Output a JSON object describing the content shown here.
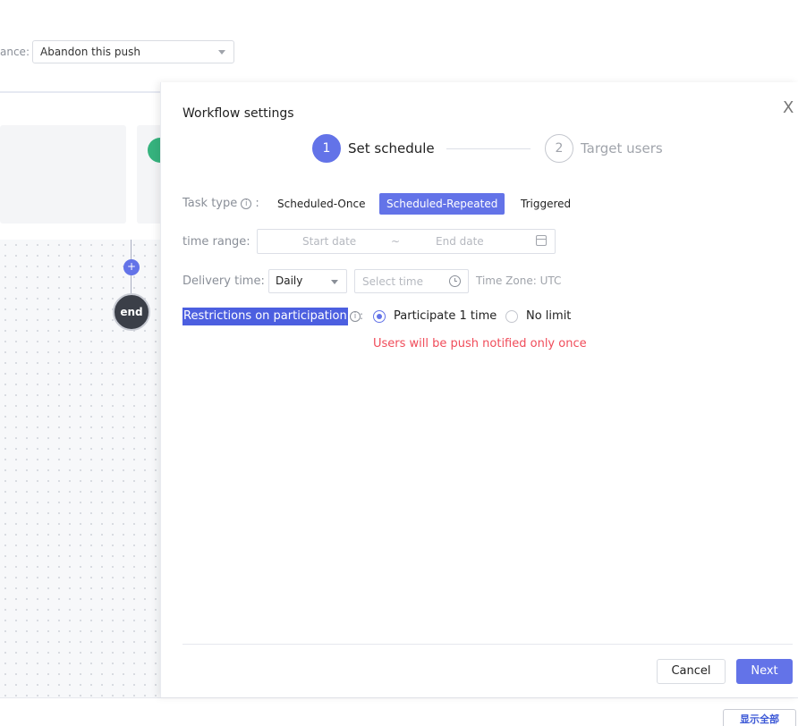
{
  "background": {
    "field_label": "ance:",
    "select_value": "Abandon this push",
    "end_node_label": "end",
    "plus_label": "+",
    "show_all_label": "显示全部"
  },
  "drawer": {
    "title": "Workflow settings",
    "close_label": "X",
    "steps": [
      {
        "number": "1",
        "label": "Set schedule",
        "state": "active"
      },
      {
        "number": "2",
        "label": "Target users",
        "state": "inactive"
      }
    ],
    "task_type": {
      "label": "Task type",
      "options": [
        "Scheduled-Once",
        "Scheduled-Repeated",
        "Triggered"
      ],
      "selected": "Scheduled-Repeated"
    },
    "time_range": {
      "label": "time range:",
      "start_placeholder": "Start date",
      "separator": "~",
      "end_placeholder": "End date"
    },
    "delivery_time": {
      "label": "Delivery time:",
      "frequency": "Daily",
      "time_placeholder": "Select time",
      "timezone": "Time Zone: UTC"
    },
    "restrictions": {
      "label": "Restrictions on participation",
      "options": [
        "Participate 1 time",
        "No limit"
      ],
      "selected": "Participate 1 time",
      "warning": "Users will be push notified only once"
    },
    "footer": {
      "cancel_label": "Cancel",
      "next_label": "Next"
    }
  },
  "colors": {
    "accent": "#6373e8",
    "warning": "#f04c5a",
    "node_green": "#36b37e"
  }
}
